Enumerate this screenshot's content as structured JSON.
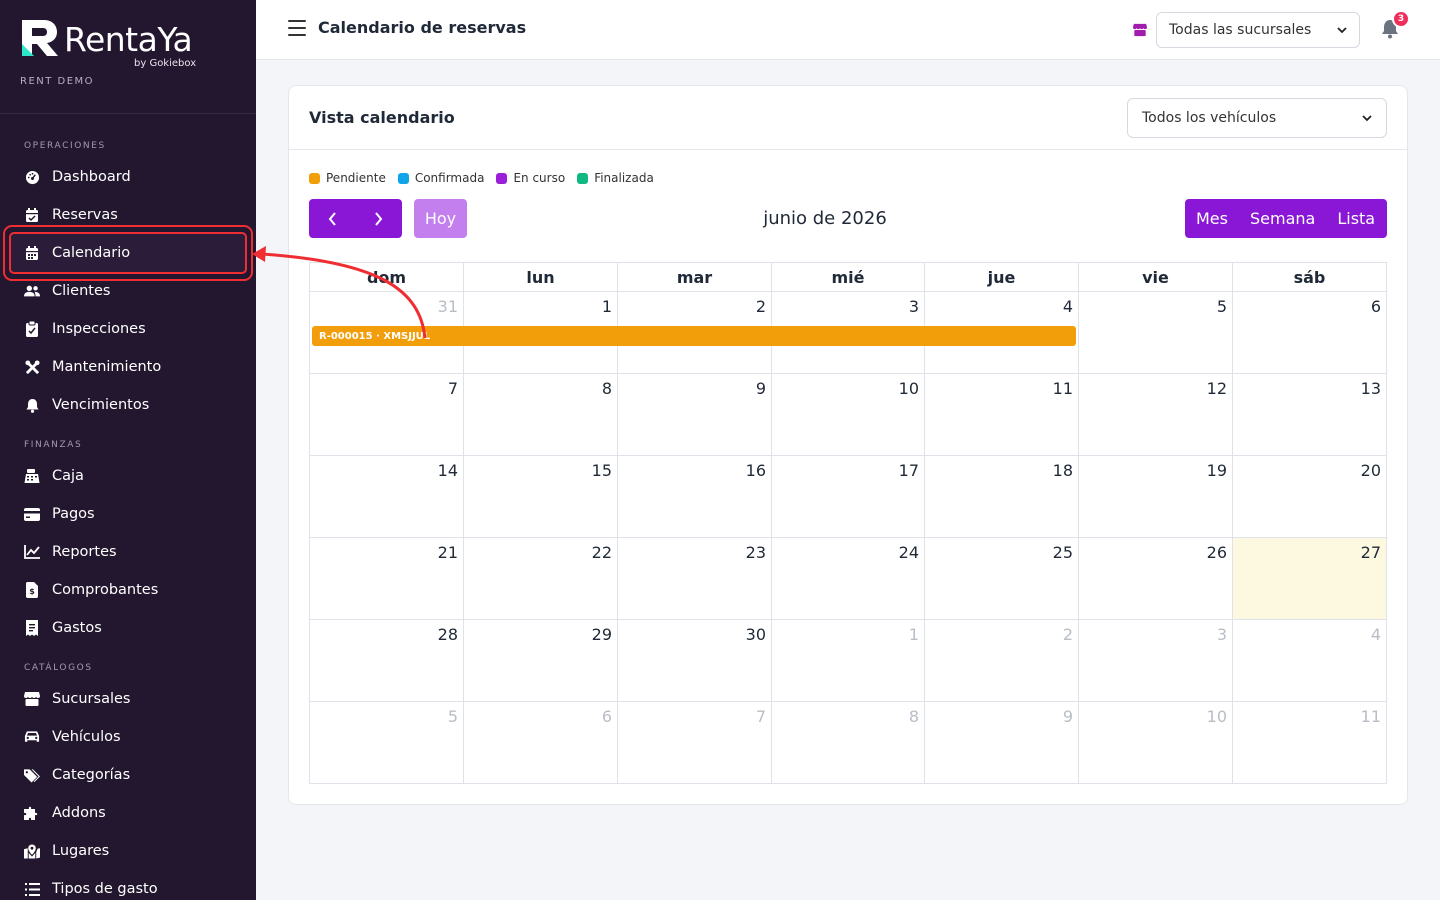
{
  "brand": {
    "name": "RentaYa",
    "byline": "by Gokiebox",
    "tenant": "RENT DEMO"
  },
  "sidebar": {
    "sections": [
      {
        "title": "OPERACIONES"
      },
      {
        "title": "FINANZAS"
      },
      {
        "title": "CATÁLOGOS"
      }
    ],
    "items": [
      {
        "label": "Dashboard",
        "icon": "dashboard-icon"
      },
      {
        "label": "Reservas",
        "icon": "calendar-check-icon"
      },
      {
        "label": "Calendario",
        "icon": "calendar-icon",
        "active": true
      },
      {
        "label": "Clientes",
        "icon": "users-icon"
      },
      {
        "label": "Inspecciones",
        "icon": "clipboard-check-icon"
      },
      {
        "label": "Mantenimiento",
        "icon": "tools-icon"
      },
      {
        "label": "Vencimientos",
        "icon": "bell-icon"
      },
      {
        "label": "Caja",
        "icon": "cash-register-icon"
      },
      {
        "label": "Pagos",
        "icon": "credit-card-icon"
      },
      {
        "label": "Reportes",
        "icon": "chart-line-icon"
      },
      {
        "label": "Comprobantes",
        "icon": "file-invoice-icon"
      },
      {
        "label": "Gastos",
        "icon": "receipt-icon"
      },
      {
        "label": "Sucursales",
        "icon": "store-icon"
      },
      {
        "label": "Vehículos",
        "icon": "car-icon"
      },
      {
        "label": "Categorías",
        "icon": "tags-icon"
      },
      {
        "label": "Addons",
        "icon": "puzzle-icon"
      },
      {
        "label": "Lugares",
        "icon": "map-location-icon"
      },
      {
        "label": "Tipos de gasto",
        "icon": "list-icon"
      }
    ]
  },
  "topbar": {
    "title": "Calendario de reservas",
    "branch_select": "Todas las sucursales",
    "notifications": "3"
  },
  "card": {
    "title": "Vista calendario",
    "vehicle_select": "Todos los vehículos"
  },
  "legend": [
    {
      "label": "Pendiente",
      "color": "#f29e0b"
    },
    {
      "label": "Confirmada",
      "color": "#0ea5e9"
    },
    {
      "label": "En curso",
      "color": "#9b1ed9"
    },
    {
      "label": "Finalizada",
      "color": "#10b981"
    }
  ],
  "toolbar": {
    "prev": "‹",
    "next": "›",
    "today": "Hoy",
    "month_title": "junio de 2026",
    "views": [
      "Mes",
      "Semana",
      "Lista"
    ]
  },
  "calendar": {
    "weekdays": [
      "dom",
      "lun",
      "mar",
      "mié",
      "jue",
      "vie",
      "sáb"
    ],
    "weeks": [
      [
        {
          "d": "31",
          "o": true
        },
        {
          "d": "1"
        },
        {
          "d": "2"
        },
        {
          "d": "3"
        },
        {
          "d": "4"
        },
        {
          "d": "5"
        },
        {
          "d": "6"
        }
      ],
      [
        {
          "d": "7"
        },
        {
          "d": "8"
        },
        {
          "d": "9"
        },
        {
          "d": "10"
        },
        {
          "d": "11"
        },
        {
          "d": "12"
        },
        {
          "d": "13"
        }
      ],
      [
        {
          "d": "14"
        },
        {
          "d": "15"
        },
        {
          "d": "16"
        },
        {
          "d": "17"
        },
        {
          "d": "18"
        },
        {
          "d": "19"
        },
        {
          "d": "20"
        }
      ],
      [
        {
          "d": "21"
        },
        {
          "d": "22"
        },
        {
          "d": "23"
        },
        {
          "d": "24"
        },
        {
          "d": "25"
        },
        {
          "d": "26"
        },
        {
          "d": "27",
          "t": true
        }
      ],
      [
        {
          "d": "28"
        },
        {
          "d": "29"
        },
        {
          "d": "30"
        },
        {
          "d": "1",
          "o": true
        },
        {
          "d": "2",
          "o": true
        },
        {
          "d": "3",
          "o": true
        },
        {
          "d": "4",
          "o": true
        }
      ],
      [
        {
          "d": "5",
          "o": true
        },
        {
          "d": "6",
          "o": true
        },
        {
          "d": "7",
          "o": true
        },
        {
          "d": "8",
          "o": true
        },
        {
          "d": "9",
          "o": true
        },
        {
          "d": "10",
          "o": true
        },
        {
          "d": "11",
          "o": true
        }
      ]
    ],
    "event": {
      "label": "R-000015 · XMSJJUL",
      "status": "Pendiente"
    }
  }
}
